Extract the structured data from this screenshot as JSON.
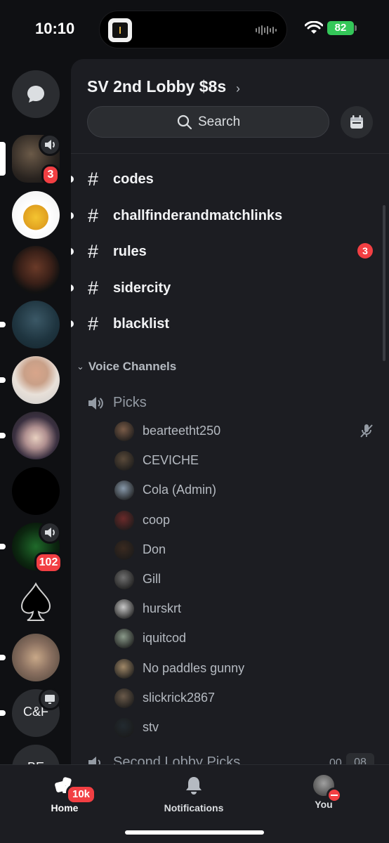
{
  "status_bar": {
    "time": "10:10",
    "battery": "82"
  },
  "server": {
    "title": "SV 2nd Lobby $8s",
    "search_label": "Search"
  },
  "rail": {
    "badges": [
      "3",
      "102"
    ],
    "text_server": "C&F",
    "text_server_partial": "BE"
  },
  "channels": [
    {
      "name": "codes",
      "unread": true,
      "badge": ""
    },
    {
      "name": "challfinderandmatchlinks",
      "unread": true,
      "badge": ""
    },
    {
      "name": "rules",
      "unread": true,
      "badge": "3"
    },
    {
      "name": "sidercity",
      "unread": true,
      "badge": ""
    },
    {
      "name": "blacklist",
      "unread": true,
      "badge": ""
    }
  ],
  "voice_category": {
    "label": "Voice Channels"
  },
  "voice_channel": {
    "name": "Picks"
  },
  "members": [
    "bearteetht250",
    "CEVICHE",
    "Cola (Admin)",
    "coop",
    "Don",
    "Gill",
    "hurskrt",
    "iquitcod",
    "No paddles gunny",
    "slickrick2867",
    "stv"
  ],
  "next_voice": {
    "name": "Second Lobby Picks",
    "count_left": "00",
    "count_right": "08"
  },
  "tabs": {
    "home": "Home",
    "home_badge": "10k",
    "notifications": "Notifications",
    "you": "You"
  },
  "colors": {
    "accent_red": "#f23f43",
    "panel_bg": "#1c1d22",
    "rail_bg": "#0f1013"
  }
}
